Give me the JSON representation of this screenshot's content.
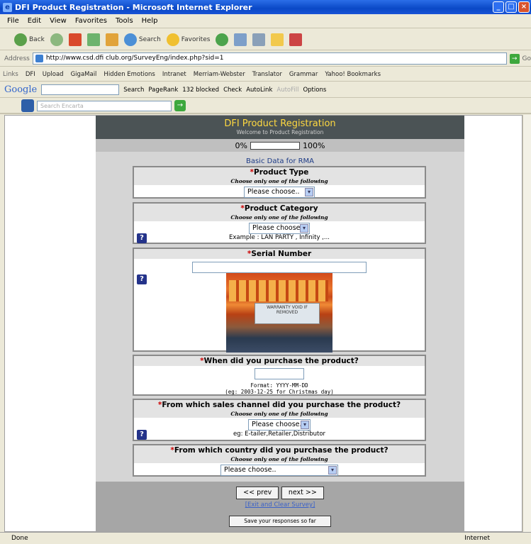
{
  "window": {
    "title": "DFI Product Registration - Microsoft Internet Explorer"
  },
  "menu": [
    "File",
    "Edit",
    "View",
    "Favorites",
    "Tools",
    "Help"
  ],
  "toolbar": {
    "back": "Back",
    "search": "Search",
    "favorites": "Favorites"
  },
  "address": {
    "label": "Address",
    "url": "http://www.csd.dfi club.org/SurveyEng/index.php?sid=1",
    "go": "Go"
  },
  "links": {
    "label": "Links",
    "items": [
      "DFI",
      "Upload",
      "GigaMail",
      "Hidden Emotions",
      "Intranet",
      "Merriam-Webster",
      "Translator",
      "Grammar",
      "Yahoo! Bookmarks"
    ]
  },
  "google": {
    "logo": "Google",
    "search": "Search",
    "pagerank": "PageRank",
    "blocked": "132 blocked",
    "check": "Check",
    "autolink": "AutoLink",
    "autofill": "AutoFill",
    "options": "Options"
  },
  "encarta": {
    "placeholder": "Search Encarta"
  },
  "survey": {
    "title": "DFI Product Registration",
    "subtitle": "Welcome to Product Registration",
    "progress_start": "0%",
    "progress_end": "100%",
    "progress_value": 0,
    "section": "Basic Data for RMA",
    "help_text": "Choose only one of the following",
    "required_mark": "*",
    "choose": "Please choose..",
    "q1": {
      "title": "Product Type"
    },
    "q2": {
      "title": "Product Category",
      "example": "Example : LAN PARTY , Infinity ,..."
    },
    "q3": {
      "title": "Serial Number",
      "photo_text": "WARRANTY VOID IF REMOVED"
    },
    "q4": {
      "title": "When did you purchase the product?",
      "format1": "Format: YYYY-MM-DD",
      "format2": "(eg: 2003-12-25 for Christmas day)"
    },
    "q5": {
      "title": "From which sales channel did you purchase the product?",
      "example": "eg: E-tailer,Retailer,Distributor"
    },
    "q6": {
      "title": "From which country did you purchase the product?"
    },
    "prev": "<< prev",
    "next": "next >>",
    "exit": "[Exit and Clear Survey]",
    "save": "Save your responses so far",
    "help_icon": "?"
  },
  "status": {
    "left": "Done",
    "right": "Internet"
  }
}
